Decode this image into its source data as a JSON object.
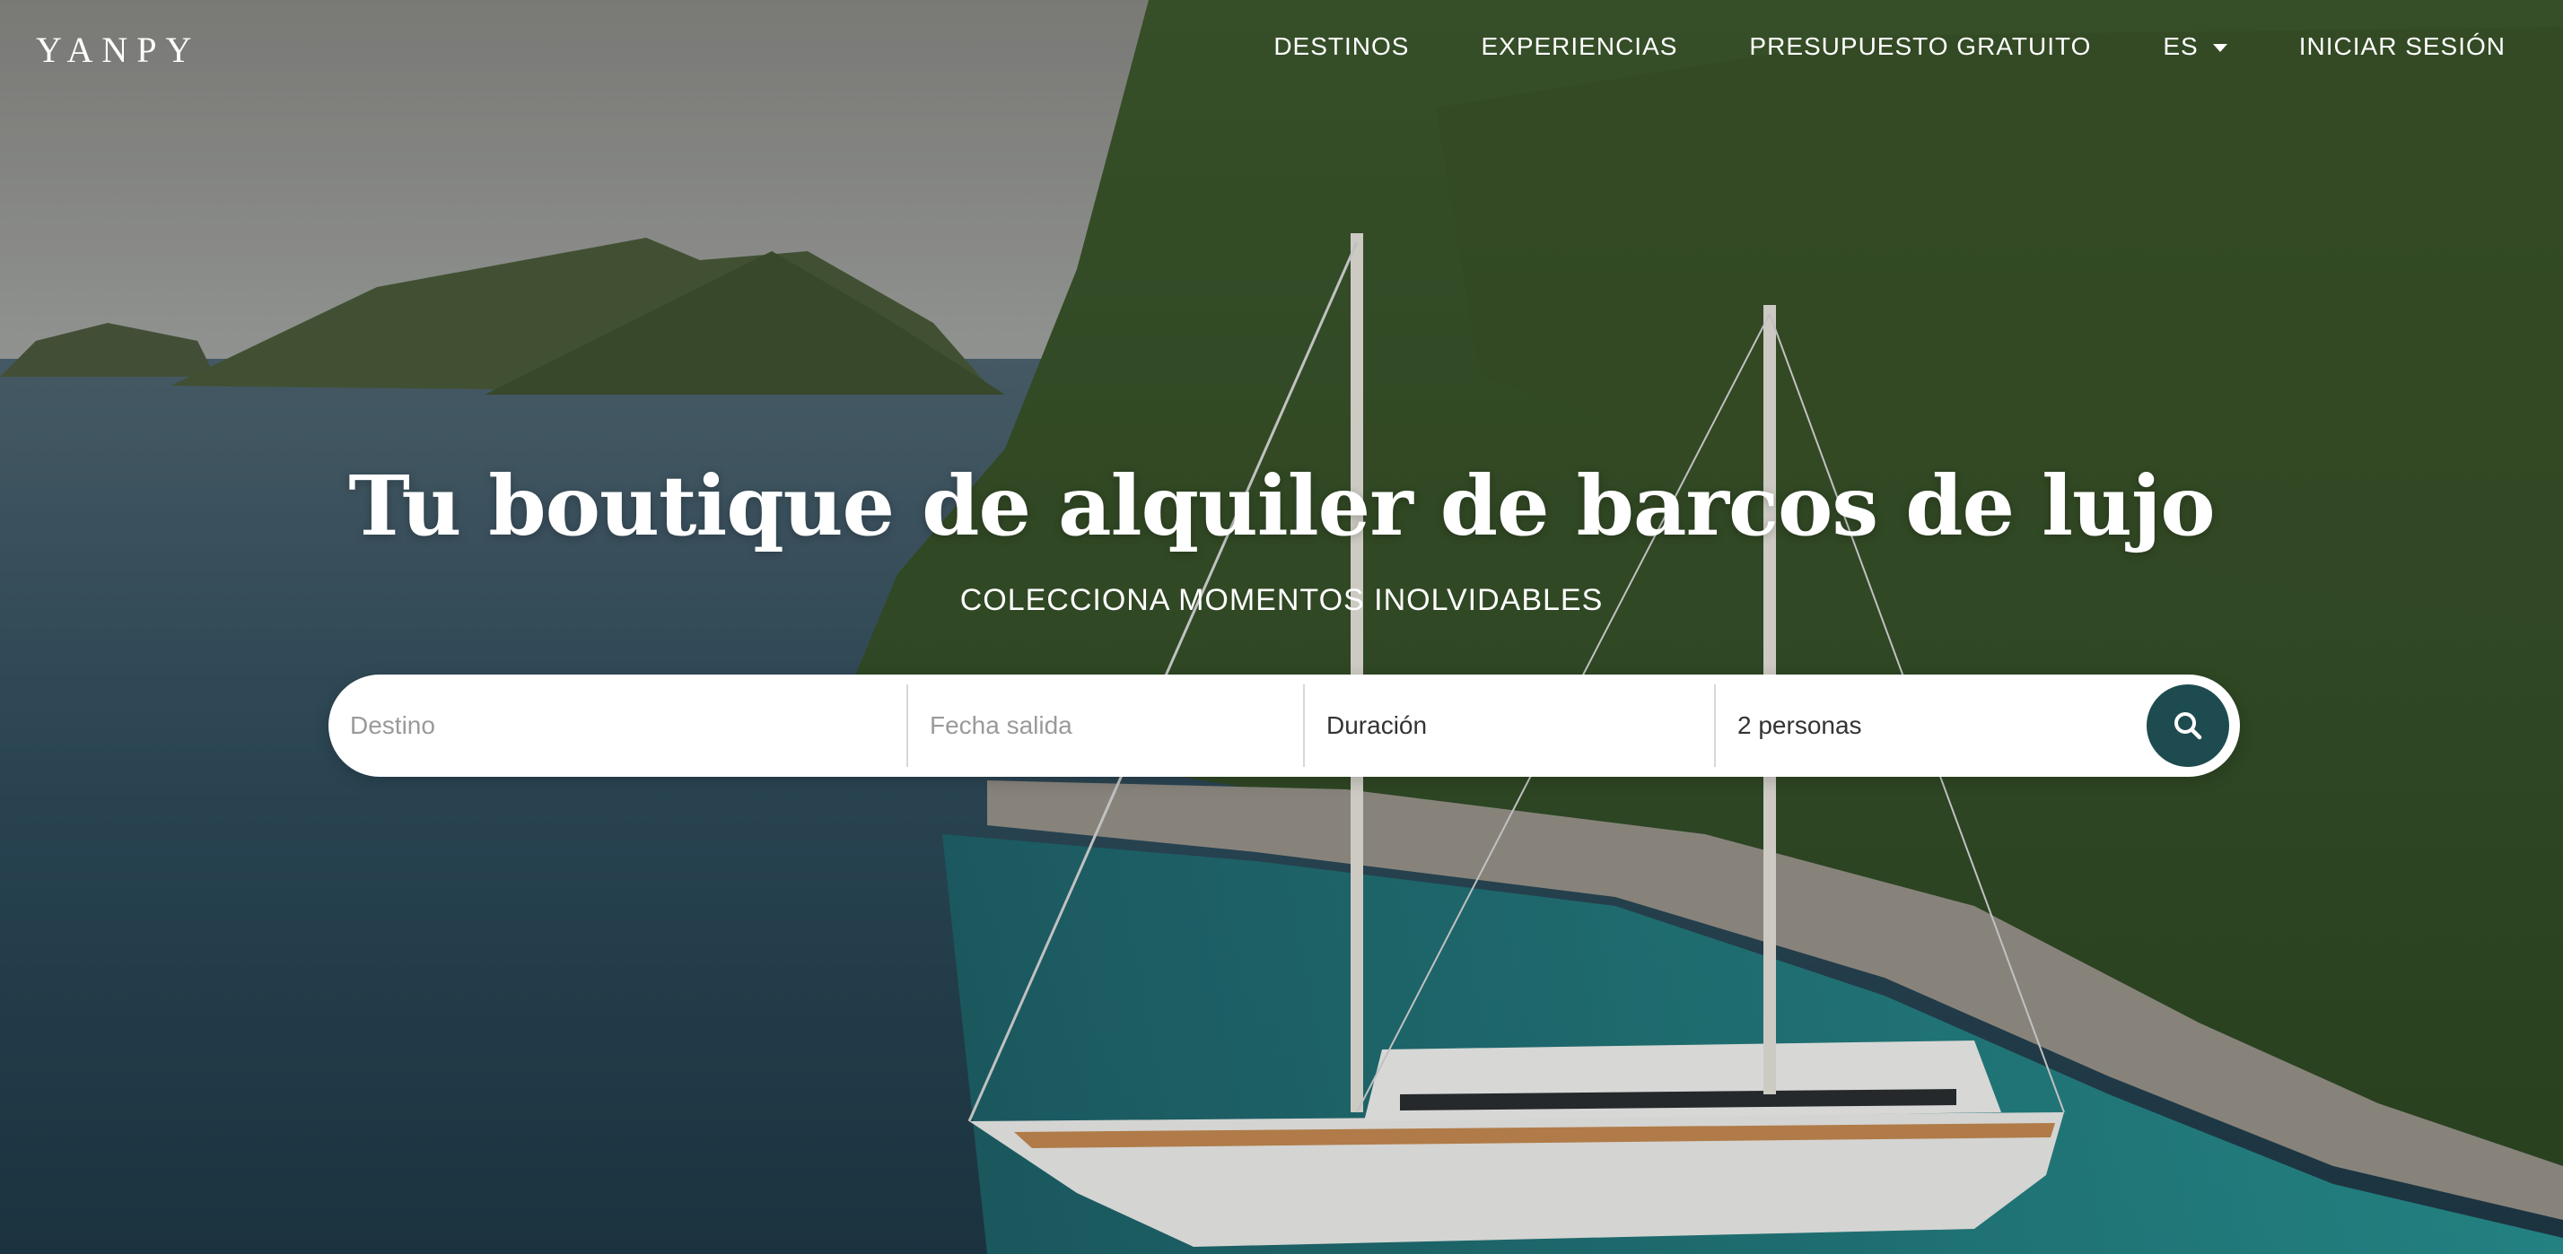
{
  "brand": {
    "logo": "YANPY"
  },
  "nav": {
    "items": [
      "DESTINOS",
      "EXPERIENCIAS",
      "PRESUPUESTO GRATUITO"
    ],
    "language": "ES",
    "login": "INICIAR SESIÓN"
  },
  "hero": {
    "title": "Tu boutique de alquiler de barcos de lujo",
    "subtitle": "COLECCIONA MOMENTOS INOLVIDABLES"
  },
  "search": {
    "destination_placeholder": "Destino",
    "date_placeholder": "Fecha salida",
    "duration_value": "Duración",
    "guests_value": "2 personas",
    "button_icon": "search-icon"
  },
  "colors": {
    "accent": "#1d4b50",
    "text_light": "#ffffff"
  }
}
